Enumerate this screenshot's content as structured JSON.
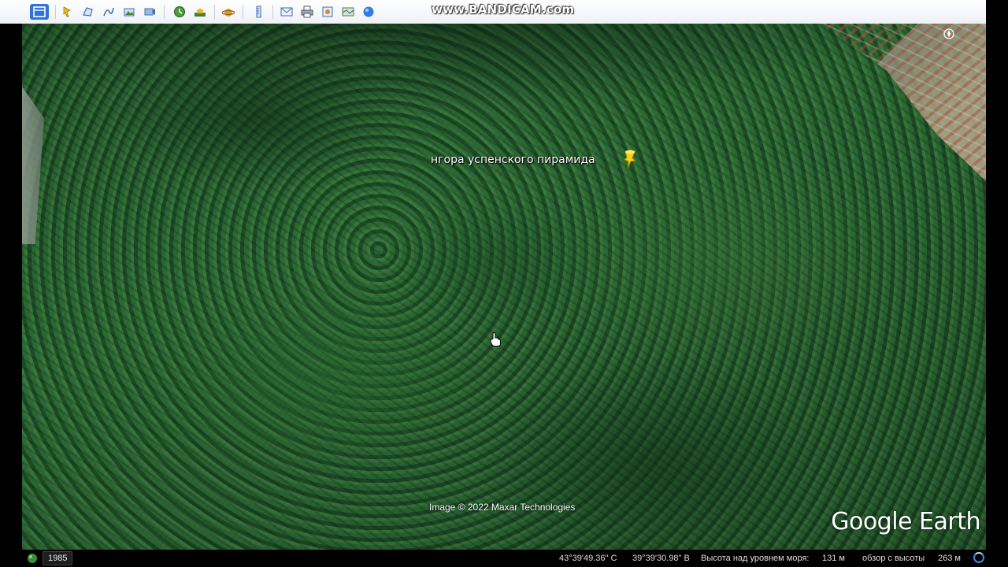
{
  "app": {
    "name": "Google Earth"
  },
  "watermark": "www.BANDICAM.com",
  "toolbar": {
    "icons": [
      "sidebar-toggle",
      "add-placemark",
      "add-polygon",
      "add-path",
      "add-image-overlay",
      "record-tour",
      "historical-imagery",
      "sunlight",
      "switch-to-sky",
      "ruler",
      "email",
      "print",
      "save-image",
      "view-in-maps",
      "sign-in"
    ]
  },
  "map": {
    "placemark_label": "нгора успенского пирамида",
    "imagery_credit": "Image © 2022 Maxar Technologies",
    "brand_logo": "Google Earth",
    "colors": {
      "forest": "#2a5f31",
      "pin": "#f2d21b"
    }
  },
  "statusbar": {
    "imagery_year": "1985",
    "latitude": "43°39'49.36\" С",
    "longitude": "39°39'30.98\" В",
    "elevation_label": "Высота над уровнем моря:",
    "elevation_value": "131 м",
    "eye_alt_label": "обзор с высоты",
    "eye_alt_value": "263 м"
  }
}
